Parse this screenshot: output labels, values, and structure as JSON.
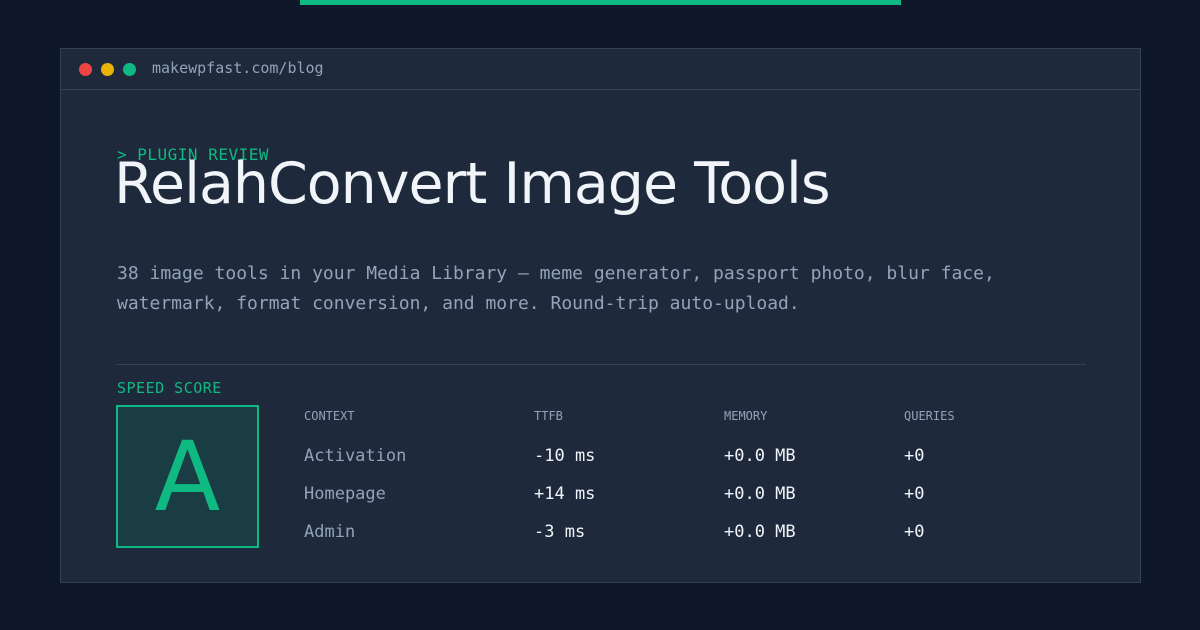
{
  "colors": {
    "background": "#0f172a",
    "panel": "#1e293b",
    "border": "#334155",
    "accent": "#10b981",
    "text_primary": "#f1f5f9",
    "text_muted": "#94a3b8",
    "dot_red": "#ef4444",
    "dot_yellow": "#eab308",
    "dot_green": "#10b981"
  },
  "window": {
    "url": "makewpfast.com/blog",
    "dots": [
      "red-dot-icon",
      "yellow-dot-icon",
      "green-dot-icon"
    ]
  },
  "article": {
    "eyebrow": "> PLUGIN REVIEW",
    "title": "RelahConvert Image Tools",
    "description": "38 image tools in your Media Library — meme generator, passport photo, blur face, watermark, format conversion, and more. Round-trip auto-upload."
  },
  "speed": {
    "label": "SPEED SCORE",
    "grade": "A",
    "headers": [
      "CONTEXT",
      "TTFB",
      "MEMORY",
      "QUERIES"
    ],
    "rows": [
      [
        "Activation",
        "-10 ms",
        "+0.0 MB",
        "+0"
      ],
      [
        "Homepage",
        "+14 ms",
        "+0.0 MB",
        "+0"
      ],
      [
        "Admin",
        "-3 ms",
        "+0.0 MB",
        "+0"
      ]
    ]
  }
}
